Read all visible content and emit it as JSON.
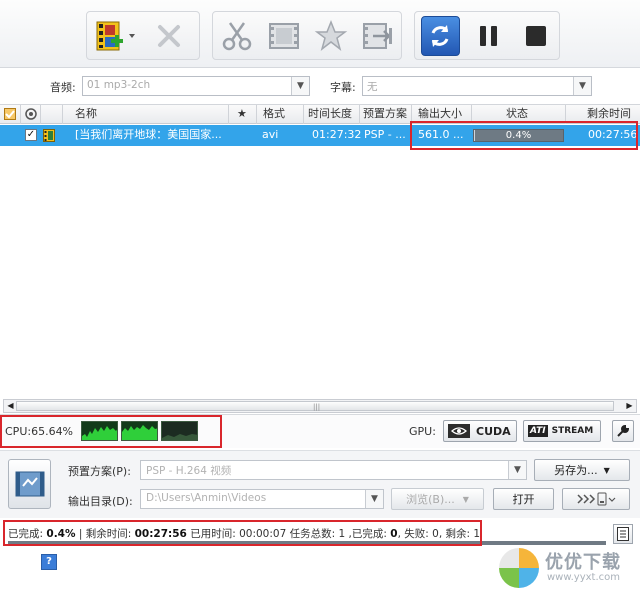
{
  "toolbar": {
    "buttons": [
      {
        "name": "add-file",
        "icon": "film-add-icon"
      },
      {
        "name": "remove",
        "icon": "x-icon"
      },
      {
        "name": "cut",
        "icon": "scissors-icon"
      },
      {
        "name": "video-edit",
        "icon": "film-icon"
      },
      {
        "name": "effects",
        "icon": "star-icon"
      },
      {
        "name": "merge",
        "icon": "film-merge-icon"
      },
      {
        "name": "convert",
        "icon": "refresh-icon"
      },
      {
        "name": "pause",
        "icon": "pause-icon"
      },
      {
        "name": "stop",
        "icon": "stop-icon"
      }
    ]
  },
  "options": {
    "audio_label": "音频:",
    "audio_value": "01 mp3-2ch",
    "subtitle_label": "字幕:",
    "subtitle_value": "无"
  },
  "table": {
    "headers": {
      "name": "名称",
      "star": "★",
      "format": "格式",
      "duration": "时间长度",
      "preset": "预置方案",
      "output_size": "输出大小",
      "status": "状态",
      "remaining": "剩余时间"
    },
    "rows": [
      {
        "checked": "✓",
        "name": "[当我们离开地球：美国国家...",
        "format": "avi",
        "duration": "01:27:32",
        "preset": "PSP - ...",
        "output_size": "561.0 ...",
        "status": "0.4%",
        "progress": 0.004,
        "remaining": "00:27:56"
      }
    ]
  },
  "status": {
    "cpu": "CPU:65.64%",
    "gpu_label": "GPU:",
    "cuda": "CUDA",
    "ati_logo": "ATI",
    "stream": "STREAM"
  },
  "settings": {
    "preset_label": "预置方案(P):",
    "preset_value": "PSP - H.264 视频",
    "save_as": "另存为...",
    "output_label": "输出目录(D):",
    "output_value": "D:\\Users\\Anmin\\Videos",
    "browse": "浏览(B)...",
    "open": "打开"
  },
  "summary": {
    "done_label": "已完成:",
    "done_value": "0.4%",
    "remain_label": "| 剩余时间:",
    "remain_value": "00:27:56",
    "elapsed_label": "已用时间:",
    "elapsed_value": "00:00:07",
    "total_label": "任务总数:",
    "total_value": "1",
    "completed_label": ",已完成:",
    "completed_value": "0",
    "failed_label": ", 失败:",
    "failed_value": "0",
    "left_label": ", 剩余:",
    "left_value": "1"
  },
  "help": "?",
  "watermark": {
    "text": "优优下载",
    "url": "www.yyxt.com"
  },
  "colors": {
    "row_selected": "#33a4ea",
    "highlight": "#d9262c",
    "convert_button": "#2f6fd1"
  }
}
